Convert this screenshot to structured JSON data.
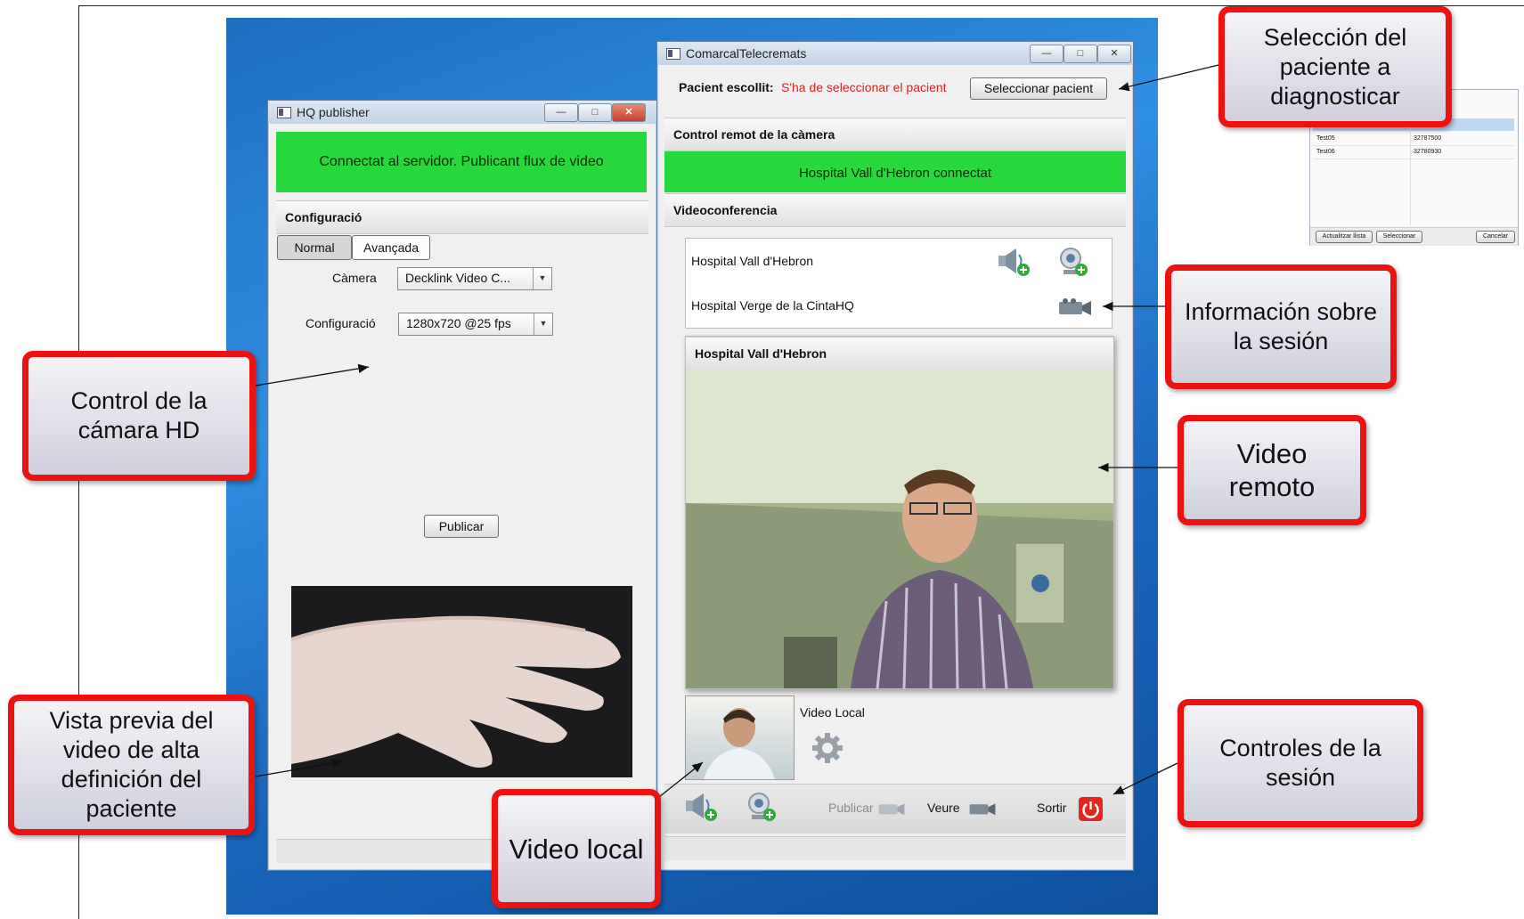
{
  "hq_window": {
    "title": "HQ publisher",
    "status": "Connectat al servidor. Publicant flux de video",
    "config_header": "Configuració",
    "tabs": [
      "Normal",
      "Avançada"
    ],
    "camera_label": "Càmera",
    "camera_value": "Decklink Video C...",
    "config_label": "Configuració",
    "config_value": "1280x720 @25 fps",
    "publish_button": "Publicar"
  },
  "tele_window": {
    "title": "ComarcalTelecremats",
    "patient_label": "Pacient escollit:",
    "patient_value": "S'ha de seleccionar el pacient",
    "select_patient_button": "Seleccionar pacient",
    "camera_control_header": "Control remot de la càmera",
    "camera_status": "Hospital Vall d'Hebron connectat",
    "videoconf_header": "Videoconferencia",
    "participants": [
      "Hospital Vall d'Hebron",
      "Hospital Verge de la CintaHQ"
    ],
    "remote_video_title": "Hospital Vall d'Hebron",
    "local_video_label": "Video Local",
    "bottom": {
      "publish_label": "Publicar",
      "watch_label": "Veure",
      "exit_label": "Sortir"
    }
  },
  "patient_list": {
    "rows": [
      [
        "Test05",
        "32787500"
      ],
      [
        "Test06",
        "32780930"
      ]
    ],
    "buttons": [
      "Actualitzar llista",
      "Seleccionar",
      "Cancelar"
    ]
  },
  "callouts": {
    "patient_selection": [
      "Selección del",
      "paciente a",
      "diagnosticar"
    ],
    "session_info": [
      "Información sobre",
      "la sesión"
    ],
    "remote_video": [
      "Video",
      "remoto"
    ],
    "session_controls": [
      "Controles de la",
      "sesión"
    ],
    "camera_control": [
      "Control de la",
      "cámara HD"
    ],
    "preview": [
      "Vista previa del",
      "video de alta",
      "definición del",
      "paciente"
    ],
    "local_video": [
      "Video local"
    ]
  },
  "colors": {
    "status_green": "#27d83c",
    "warning_red": "#e02020",
    "callout_border": "#ee1111"
  },
  "icons": [
    "speaker-add-icon",
    "webcam-add-icon",
    "camcorder-icon",
    "gear-icon",
    "power-icon"
  ]
}
